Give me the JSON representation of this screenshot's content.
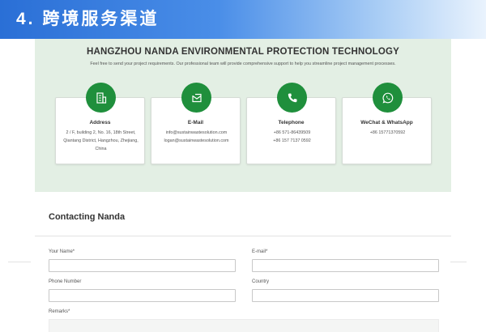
{
  "banner": {
    "title": "4. 跨境服务渠道"
  },
  "contact_panel": {
    "company": "HANGZHOU NANDA ENVIRONMENTAL PROTECTION TECHNOLOGY",
    "intro": "Feel free to send your project requirements. Our professional team will provide comprehensive support to help you streamline project management processes.",
    "cards": [
      {
        "icon": "building-icon",
        "title": "Address",
        "lines": [
          "2 / F, building 2, No. 16, 18th Street,",
          "Qiantang District, Hangzhou, Zhejiang,",
          "China"
        ]
      },
      {
        "icon": "mail-icon",
        "title": "E-Mail",
        "lines": [
          "info@sustainwastesolution.com",
          "logan@sustainwastesolution.com"
        ]
      },
      {
        "icon": "phone-icon",
        "title": "Telephone",
        "lines": [
          "+86 571-86439509",
          "+86 157 7137 0592"
        ]
      },
      {
        "icon": "whatsapp-icon",
        "title": "WeChat & WhatsApp",
        "lines": [
          "+86 15771370592"
        ]
      }
    ],
    "accent_color": "#1f8f3c"
  },
  "form": {
    "title": "Contacting Nanda",
    "fields": {
      "name_label": "Your Name*",
      "email_label": "E-mail*",
      "phone_label": "Phone Number",
      "country_label": "Country",
      "remarks_label": "Remarks*"
    }
  }
}
